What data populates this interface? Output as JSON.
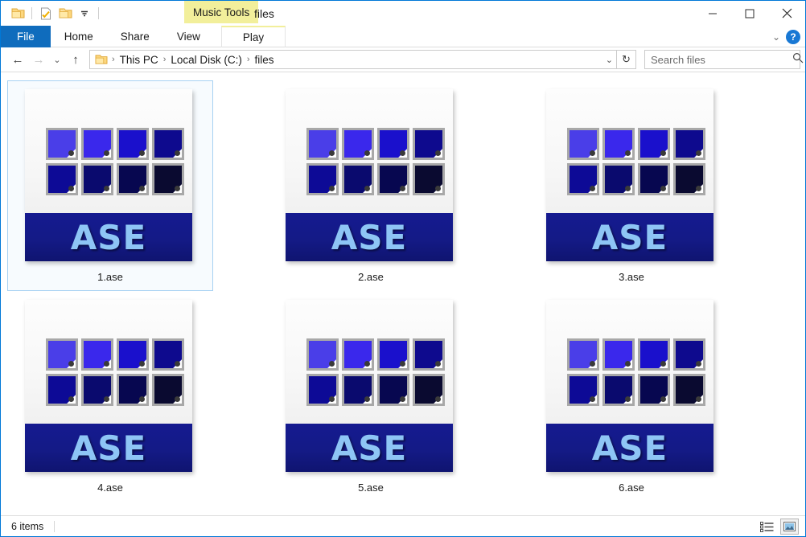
{
  "window": {
    "title": "files",
    "contextual_tab_group": "Music Tools",
    "quick_access": [
      {
        "name": "folder-icon",
        "label": "Folder"
      },
      {
        "name": "properties-icon",
        "label": "Properties"
      },
      {
        "name": "new-folder-icon",
        "label": "New folder"
      },
      {
        "name": "chevron-down-icon",
        "label": "Customize Quick Access Toolbar"
      }
    ],
    "controls": {
      "minimize": "─",
      "maximize": "☐",
      "close": "✕"
    }
  },
  "ribbon": {
    "tabs": [
      {
        "label": "File",
        "selected": true
      },
      {
        "label": "Home",
        "selected": false
      },
      {
        "label": "Share",
        "selected": false
      },
      {
        "label": "View",
        "selected": false
      }
    ],
    "contextual_tabs": [
      {
        "label": "Play",
        "selected": false
      }
    ],
    "collapse_icon": "⌄",
    "help_label": "?"
  },
  "address_bar": {
    "back_icon": "←",
    "forward_icon": "→",
    "recent_icon": "⌄",
    "up_icon": "↑",
    "folder_icon": "folder-icon",
    "breadcrumbs": [
      "This PC",
      "Local Disk (C:)",
      "files"
    ],
    "separator": "›",
    "dropdown_icon": "⌄",
    "refresh_icon": "↻"
  },
  "search": {
    "placeholder": "Search files",
    "value": "",
    "icon": "search-icon"
  },
  "files": [
    {
      "name": "1.ase",
      "selected": true
    },
    {
      "name": "2.ase",
      "selected": false
    },
    {
      "name": "3.ase",
      "selected": false
    },
    {
      "name": "4.ase",
      "selected": false
    },
    {
      "name": "5.ase",
      "selected": false
    },
    {
      "name": "6.ase",
      "selected": false
    }
  ],
  "icon": {
    "label": "ASE",
    "swatch_colors": [
      "#4a3ee8",
      "#3a28ec",
      "#1a10cc",
      "#0e0a8e",
      "#0d0a96",
      "#0a0a6e",
      "#070750",
      "#0a0a30"
    ],
    "band_color": "#151a90",
    "text_color": "#8ec5f5"
  },
  "status_bar": {
    "item_count": "6 items",
    "views": [
      {
        "name": "details-view-button",
        "active": false
      },
      {
        "name": "large-icons-view-button",
        "active": true
      }
    ]
  }
}
